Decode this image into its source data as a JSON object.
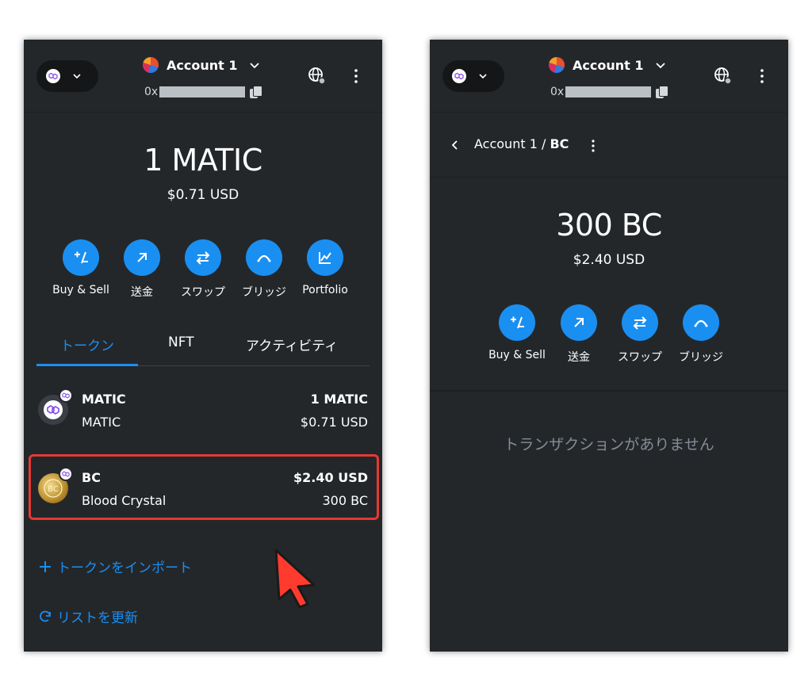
{
  "left": {
    "header": {
      "account_name": "Account 1",
      "address_prefix": "0x"
    },
    "balance": {
      "primary": "1 MATIC",
      "fiat": "$0.71 USD"
    },
    "actions": [
      {
        "label": "Buy & Sell",
        "icon": "plus-minus-icon"
      },
      {
        "label": "送金",
        "icon": "arrow-up-right-icon"
      },
      {
        "label": "スワップ",
        "icon": "swap-arrows-icon"
      },
      {
        "label": "ブリッジ",
        "icon": "bridge-icon"
      },
      {
        "label": "Portfolio",
        "icon": "chart-icon"
      }
    ],
    "tabs": [
      {
        "label": "トークン",
        "active": true
      },
      {
        "label": "NFT",
        "active": false
      },
      {
        "label": "アクティビティ",
        "active": false
      }
    ],
    "tokens": [
      {
        "name": "MATIC",
        "subtitle": "MATIC",
        "value_primary": "1 MATIC",
        "value_secondary": "$0.71 USD"
      },
      {
        "name": "BC",
        "subtitle": "Blood Crystal",
        "value_primary": "$2.40 USD",
        "value_secondary": "300 BC"
      }
    ],
    "import_link": "トークンをインポート",
    "refresh_link": "リストを更新"
  },
  "right": {
    "header": {
      "account_name": "Account 1",
      "address_prefix": "0x"
    },
    "breadcrumb": {
      "account": "Account 1 / ",
      "token": "BC"
    },
    "balance": {
      "primary": "300 BC",
      "fiat": "$2.40 USD"
    },
    "actions": [
      {
        "label": "Buy & Sell",
        "icon": "plus-minus-icon"
      },
      {
        "label": "送金",
        "icon": "arrow-up-right-icon"
      },
      {
        "label": "スワップ",
        "icon": "swap-arrows-icon"
      },
      {
        "label": "ブリッジ",
        "icon": "bridge-icon"
      }
    ],
    "empty_message": "トランザクションがありません"
  },
  "colors": {
    "background": "#24272a",
    "accent": "#1a8ff2",
    "highlight": "#e53935",
    "muted_text": "#848c96"
  }
}
